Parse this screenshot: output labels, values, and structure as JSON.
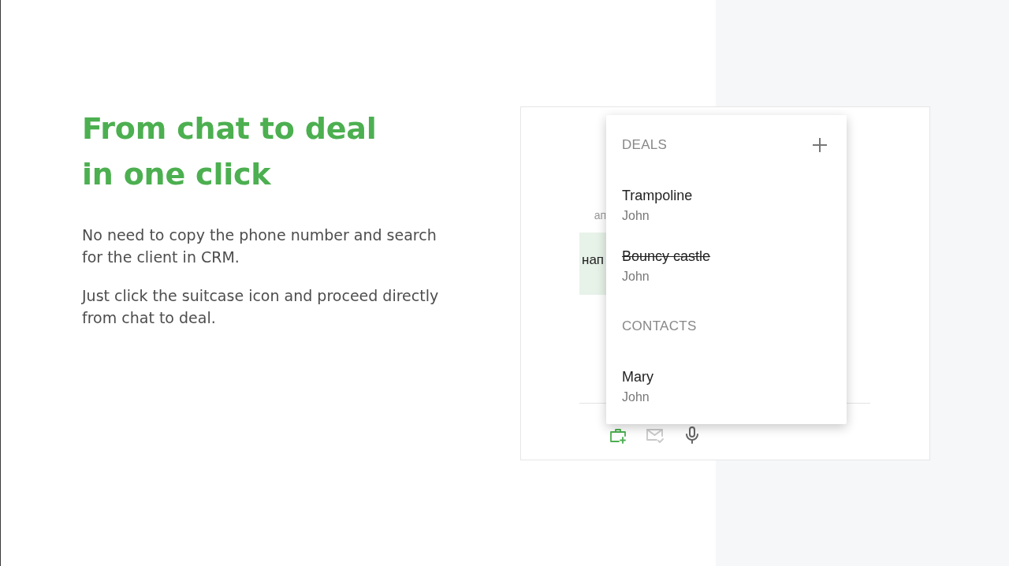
{
  "hero": {
    "headline": "From chat to deal in one click",
    "paragraphs": [
      "No need to copy the phone number and search for the client in CRM.",
      "Just click the suitcase icon and proceed directly from chat to deal."
    ]
  },
  "chat": {
    "messages": [
      {
        "kind": "caption",
        "text": "ап"
      },
      {
        "kind": "bubble",
        "text": "нап"
      }
    ]
  },
  "dropdown": {
    "sections": [
      {
        "title": "DEALS",
        "addable": true,
        "items": [
          {
            "title": "Trampoline",
            "subtitle": "John",
            "closed": false
          },
          {
            "title": "Bouncy castle",
            "subtitle": "John",
            "closed": true
          }
        ]
      },
      {
        "title": "CONTACTS",
        "addable": false,
        "items": [
          {
            "title": "Mary",
            "subtitle": "John",
            "closed": false
          }
        ]
      }
    ]
  },
  "toolbar": [
    {
      "selected": true,
      "disabled": false
    },
    {
      "selected": false,
      "disabled": true
    },
    {
      "selected": false,
      "disabled": false
    }
  ]
}
